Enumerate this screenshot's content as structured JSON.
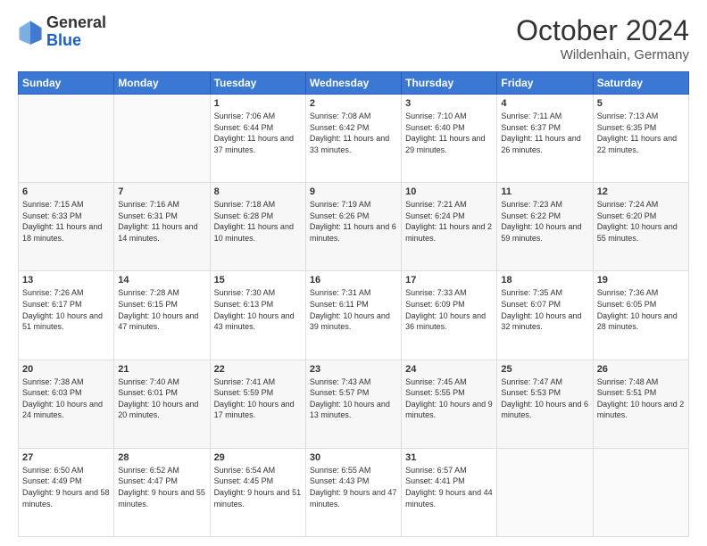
{
  "header": {
    "logo_general": "General",
    "logo_blue": "Blue",
    "month": "October 2024",
    "location": "Wildenhain, Germany"
  },
  "weekdays": [
    "Sunday",
    "Monday",
    "Tuesday",
    "Wednesday",
    "Thursday",
    "Friday",
    "Saturday"
  ],
  "weeks": [
    [
      {
        "day": "",
        "info": ""
      },
      {
        "day": "",
        "info": ""
      },
      {
        "day": "1",
        "info": "Sunrise: 7:06 AM\nSunset: 6:44 PM\nDaylight: 11 hours and 37 minutes."
      },
      {
        "day": "2",
        "info": "Sunrise: 7:08 AM\nSunset: 6:42 PM\nDaylight: 11 hours and 33 minutes."
      },
      {
        "day": "3",
        "info": "Sunrise: 7:10 AM\nSunset: 6:40 PM\nDaylight: 11 hours and 29 minutes."
      },
      {
        "day": "4",
        "info": "Sunrise: 7:11 AM\nSunset: 6:37 PM\nDaylight: 11 hours and 26 minutes."
      },
      {
        "day": "5",
        "info": "Sunrise: 7:13 AM\nSunset: 6:35 PM\nDaylight: 11 hours and 22 minutes."
      }
    ],
    [
      {
        "day": "6",
        "info": "Sunrise: 7:15 AM\nSunset: 6:33 PM\nDaylight: 11 hours and 18 minutes."
      },
      {
        "day": "7",
        "info": "Sunrise: 7:16 AM\nSunset: 6:31 PM\nDaylight: 11 hours and 14 minutes."
      },
      {
        "day": "8",
        "info": "Sunrise: 7:18 AM\nSunset: 6:28 PM\nDaylight: 11 hours and 10 minutes."
      },
      {
        "day": "9",
        "info": "Sunrise: 7:19 AM\nSunset: 6:26 PM\nDaylight: 11 hours and 6 minutes."
      },
      {
        "day": "10",
        "info": "Sunrise: 7:21 AM\nSunset: 6:24 PM\nDaylight: 11 hours and 2 minutes."
      },
      {
        "day": "11",
        "info": "Sunrise: 7:23 AM\nSunset: 6:22 PM\nDaylight: 10 hours and 59 minutes."
      },
      {
        "day": "12",
        "info": "Sunrise: 7:24 AM\nSunset: 6:20 PM\nDaylight: 10 hours and 55 minutes."
      }
    ],
    [
      {
        "day": "13",
        "info": "Sunrise: 7:26 AM\nSunset: 6:17 PM\nDaylight: 10 hours and 51 minutes."
      },
      {
        "day": "14",
        "info": "Sunrise: 7:28 AM\nSunset: 6:15 PM\nDaylight: 10 hours and 47 minutes."
      },
      {
        "day": "15",
        "info": "Sunrise: 7:30 AM\nSunset: 6:13 PM\nDaylight: 10 hours and 43 minutes."
      },
      {
        "day": "16",
        "info": "Sunrise: 7:31 AM\nSunset: 6:11 PM\nDaylight: 10 hours and 39 minutes."
      },
      {
        "day": "17",
        "info": "Sunrise: 7:33 AM\nSunset: 6:09 PM\nDaylight: 10 hours and 36 minutes."
      },
      {
        "day": "18",
        "info": "Sunrise: 7:35 AM\nSunset: 6:07 PM\nDaylight: 10 hours and 32 minutes."
      },
      {
        "day": "19",
        "info": "Sunrise: 7:36 AM\nSunset: 6:05 PM\nDaylight: 10 hours and 28 minutes."
      }
    ],
    [
      {
        "day": "20",
        "info": "Sunrise: 7:38 AM\nSunset: 6:03 PM\nDaylight: 10 hours and 24 minutes."
      },
      {
        "day": "21",
        "info": "Sunrise: 7:40 AM\nSunset: 6:01 PM\nDaylight: 10 hours and 20 minutes."
      },
      {
        "day": "22",
        "info": "Sunrise: 7:41 AM\nSunset: 5:59 PM\nDaylight: 10 hours and 17 minutes."
      },
      {
        "day": "23",
        "info": "Sunrise: 7:43 AM\nSunset: 5:57 PM\nDaylight: 10 hours and 13 minutes."
      },
      {
        "day": "24",
        "info": "Sunrise: 7:45 AM\nSunset: 5:55 PM\nDaylight: 10 hours and 9 minutes."
      },
      {
        "day": "25",
        "info": "Sunrise: 7:47 AM\nSunset: 5:53 PM\nDaylight: 10 hours and 6 minutes."
      },
      {
        "day": "26",
        "info": "Sunrise: 7:48 AM\nSunset: 5:51 PM\nDaylight: 10 hours and 2 minutes."
      }
    ],
    [
      {
        "day": "27",
        "info": "Sunrise: 6:50 AM\nSunset: 4:49 PM\nDaylight: 9 hours and 58 minutes."
      },
      {
        "day": "28",
        "info": "Sunrise: 6:52 AM\nSunset: 4:47 PM\nDaylight: 9 hours and 55 minutes."
      },
      {
        "day": "29",
        "info": "Sunrise: 6:54 AM\nSunset: 4:45 PM\nDaylight: 9 hours and 51 minutes."
      },
      {
        "day": "30",
        "info": "Sunrise: 6:55 AM\nSunset: 4:43 PM\nDaylight: 9 hours and 47 minutes."
      },
      {
        "day": "31",
        "info": "Sunrise: 6:57 AM\nSunset: 4:41 PM\nDaylight: 9 hours and 44 minutes."
      },
      {
        "day": "",
        "info": ""
      },
      {
        "day": "",
        "info": ""
      }
    ]
  ]
}
